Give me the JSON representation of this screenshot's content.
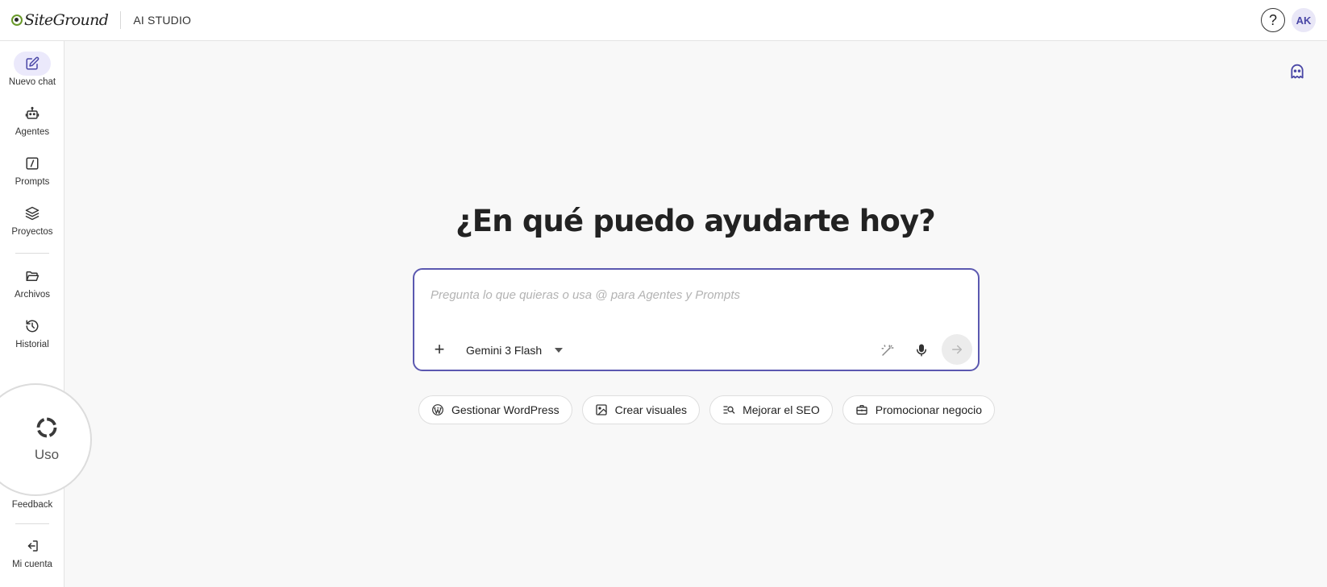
{
  "header": {
    "brand": "SiteGround",
    "product": "AI STUDIO",
    "help_glyph": "?",
    "avatar_initials": "AK"
  },
  "sidebar": {
    "items": [
      {
        "label": "Nuevo chat",
        "icon": "edit-icon",
        "active": true
      },
      {
        "label": "Agentes",
        "icon": "robot-icon"
      },
      {
        "label": "Prompts",
        "icon": "slash-square-icon"
      },
      {
        "label": "Proyectos",
        "icon": "layers-icon"
      },
      {
        "label": "Archivos",
        "icon": "folder-open-icon"
      },
      {
        "label": "Historial",
        "icon": "history-icon"
      },
      {
        "label": "Feedback",
        "icon": "feedback-icon"
      },
      {
        "label": "Mi cuenta",
        "icon": "sign-out-icon"
      }
    ],
    "usage_label": "Uso"
  },
  "main": {
    "headline": "¿En qué puedo ayudarte hoy?",
    "composer": {
      "value": "",
      "placeholder": "Pregunta lo que quieras o usa @ para Agentes y Prompts",
      "model": "Gemini 3 Flash"
    },
    "suggestions": [
      {
        "label": "Gestionar WordPress",
        "icon": "wordpress-icon"
      },
      {
        "label": "Crear visuales",
        "icon": "image-icon"
      },
      {
        "label": "Mejorar el SEO",
        "icon": "search-list-icon"
      },
      {
        "label": "Promocionar negocio",
        "icon": "briefcase-icon"
      }
    ]
  },
  "colors": {
    "accent": "#5b58b0",
    "active_bg": "#ebe9fb",
    "logo_green": "#6a9a2a",
    "background": "#f8f8f8"
  }
}
